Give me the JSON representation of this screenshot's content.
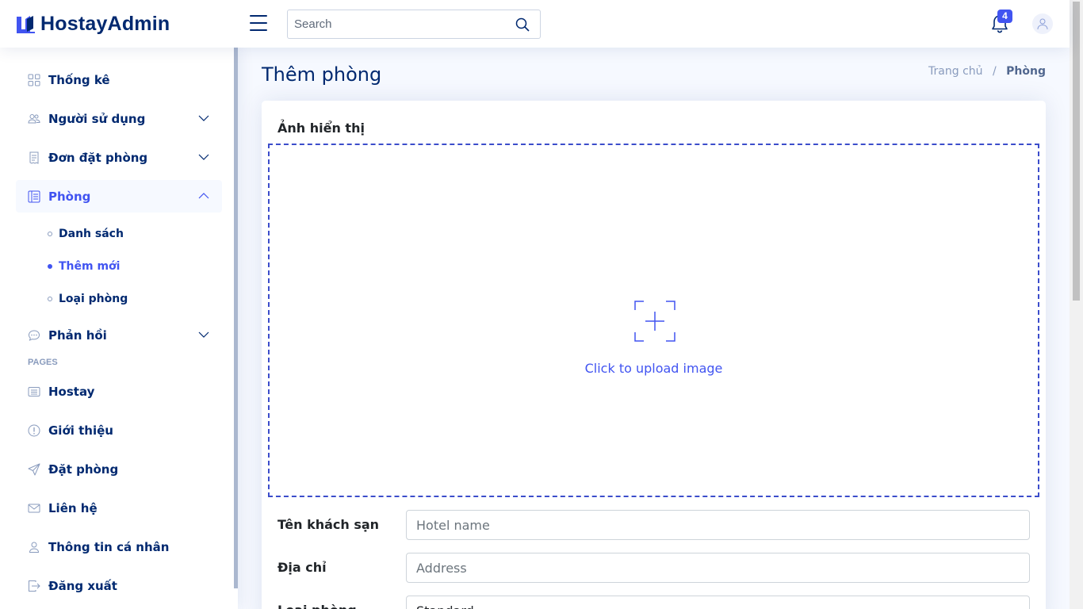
{
  "header": {
    "logo_text": "HostayAdmin",
    "search_placeholder": "Search",
    "notification_count": "4"
  },
  "sidebar": {
    "items": [
      {
        "label": "Thống kê",
        "icon": "grid-icon"
      },
      {
        "label": "Người sử dụng",
        "icon": "people-icon"
      },
      {
        "label": "Đơn đặt phòng",
        "icon": "receipt-icon"
      },
      {
        "label": "Phòng",
        "icon": "layout-text-icon"
      },
      {
        "label": "Phản hồi",
        "icon": "chat-icon"
      }
    ],
    "rooms_sub": [
      {
        "label": "Danh sách",
        "active": false
      },
      {
        "label": "Thêm mới",
        "active": true
      },
      {
        "label": "Loại phòng",
        "active": false
      }
    ],
    "pages_heading": "PAGES",
    "pages": [
      {
        "label": "Hostay",
        "icon": "card-list-icon"
      },
      {
        "label": "Giới thiệu",
        "icon": "info-circle-icon"
      },
      {
        "label": "Đặt phòng",
        "icon": "send-icon"
      },
      {
        "label": "Liên hệ",
        "icon": "envelope-icon"
      },
      {
        "label": "Thông tin cá nhân",
        "icon": "person-icon"
      },
      {
        "label": "Đăng xuất",
        "icon": "box-arrow-right-icon"
      }
    ]
  },
  "main": {
    "title": "Thêm phòng",
    "breadcrumb": {
      "home": "Trang chủ",
      "current": "Phòng"
    },
    "upload_label": "Ảnh hiển thị",
    "upload_text": "Click to upload image",
    "fields": [
      {
        "label": "Tên khách sạn",
        "placeholder": "Hotel name",
        "value": ""
      },
      {
        "label": "Địa chỉ",
        "placeholder": "Address",
        "value": ""
      },
      {
        "label": "Loại phòng",
        "placeholder": "",
        "value": "Standard"
      }
    ]
  },
  "colors": {
    "primary": "#4154f1",
    "navy": "#012970",
    "background": "#f6f9ff"
  }
}
